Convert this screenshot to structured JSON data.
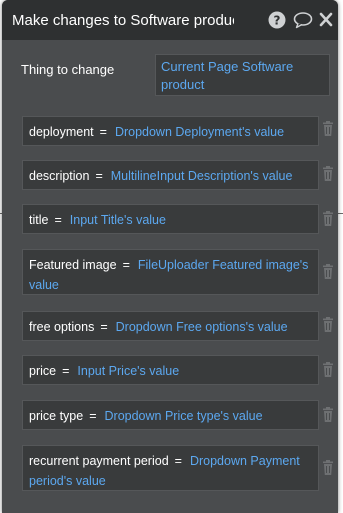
{
  "dialog": {
    "title": "Make changes to Software product"
  },
  "header_icons": [
    "help-icon",
    "comment-icon",
    "close-icon"
  ],
  "thing": {
    "label": "Thing to change",
    "value": "Current Page Software product"
  },
  "fields": [
    {
      "key": "deployment",
      "value": "Dropdown Deployment's value"
    },
    {
      "key": "description",
      "value": "MultilineInput Description's value"
    },
    {
      "key": "title",
      "value": "Input Title's value"
    },
    {
      "key": "Featured image",
      "value": "FileUploader Featured image's value"
    },
    {
      "key": "free options",
      "value": "Dropdown Free options's value"
    },
    {
      "key": "price",
      "value": "Input Price's value"
    },
    {
      "key": "price type",
      "value": "Dropdown Price type's value"
    },
    {
      "key": "recurrent payment period",
      "value": "Dropdown Payment period's value"
    }
  ],
  "equals_sign": "=",
  "colors": {
    "panel_bg": "#4a4c4e",
    "header_bg": "#2e3031",
    "field_bg": "#393b3c",
    "value_text": "#5ca8f0",
    "label_text": "#ffffff",
    "trash_icon": "#6e7072"
  }
}
